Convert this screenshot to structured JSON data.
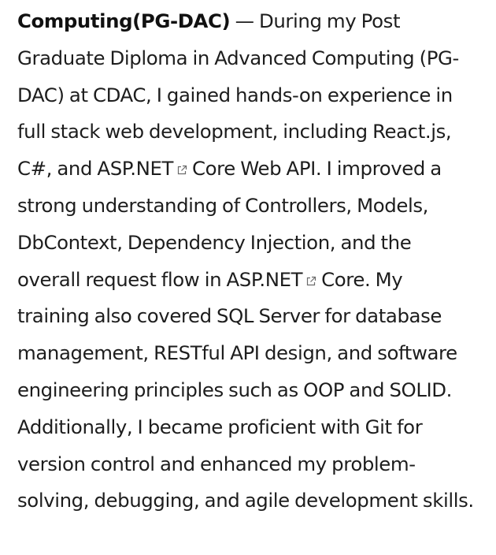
{
  "content": {
    "heading": "Computing(PG-DAC)",
    "dash": " — ",
    "text_1": "During my Post Graduate Diploma in Advanced Computing (PG-DAC) at CDAC, I gained hands-on experience in full stack web development, including React.js, C#, and ",
    "link_1": "ASP.NET",
    "text_2": "Core Web API. I improved a strong understanding of Controllers, Models, DbContext, Dependency Injection, and the overall request flow in ",
    "link_2": "ASP.NET",
    "text_3": "Core. My training also covered SQL Server for database management, RESTful API design, and software engineering principles such as OOP and SOLID. Additionally, I became proficient with Git for version control and enhanced my problem-solving, debugging, and agile development skills.",
    "icon": "external-link-icon",
    "text_color": "#1d1d1d",
    "icon_color": "#6b6b6b"
  }
}
